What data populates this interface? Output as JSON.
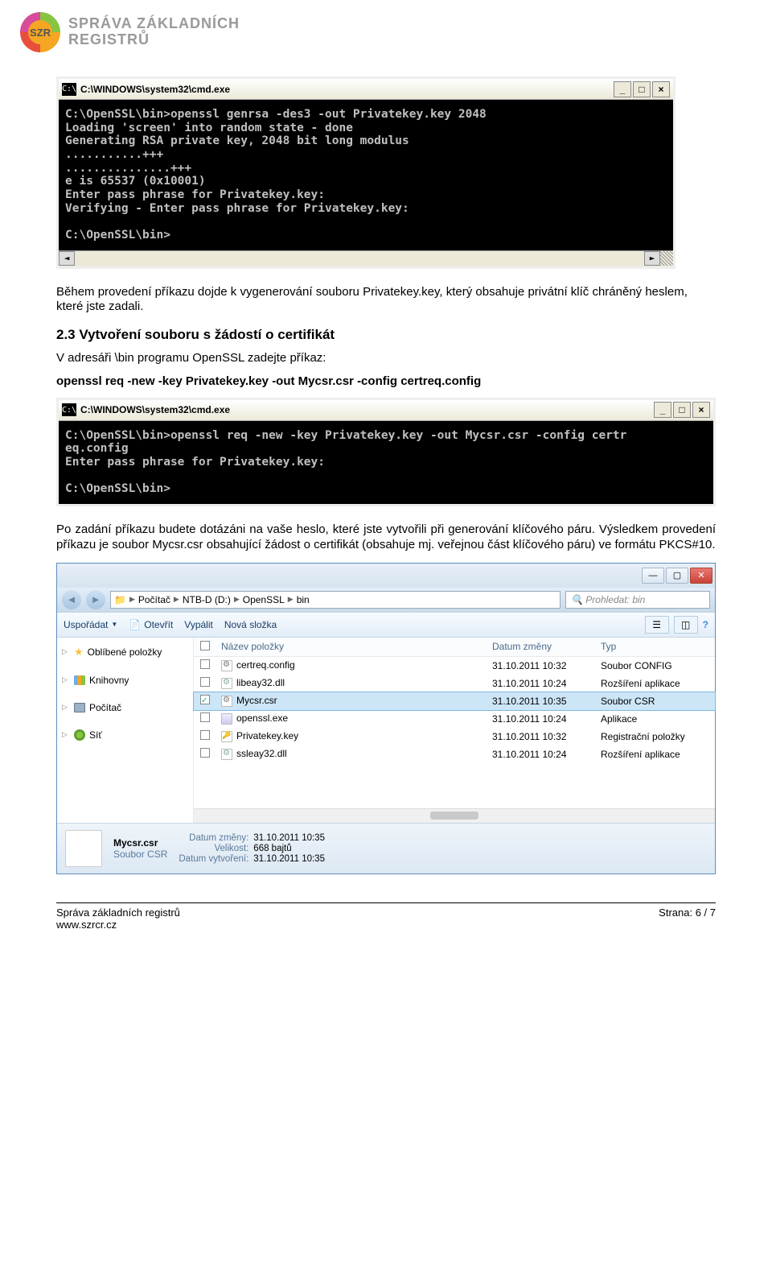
{
  "logo": {
    "abbr": "SZR",
    "title_l1": "SPRÁVA ZÁKLADNÍCH",
    "title_l2": "REGISTRŮ"
  },
  "cmd1": {
    "title": "C:\\WINDOWS\\system32\\cmd.exe",
    "icon_text": "C:\\",
    "body": "C:\\OpenSSL\\bin>openssl genrsa -des3 -out Privatekey.key 2048\nLoading 'screen' into random state - done\nGenerating RSA private key, 2048 bit long modulus\n...........+++\n...............+++\ne is 65537 (0x10001)\nEnter pass phrase for Privatekey.key:\nVerifying - Enter pass phrase for Privatekey.key:\n\nC:\\OpenSSL\\bin>"
  },
  "para1": "Během provedení příkazu dojde k vygenerování souboru Privatekey.key, který obsahuje privátní klíč chráněný heslem, které jste zadali.",
  "heading23": "2.3  Vytvoření souboru s žádostí o certifikát",
  "para2": "V adresáři \\bin programu OpenSSL zadejte příkaz:",
  "command2": "openssl req -new -key Privatekey.key -out Mycsr.csr -config certreq.config",
  "cmd2": {
    "title": "C:\\WINDOWS\\system32\\cmd.exe",
    "icon_text": "C:\\",
    "body": "C:\\OpenSSL\\bin>openssl req -new -key Privatekey.key -out Mycsr.csr -config certr\neq.config\nEnter pass phrase for Privatekey.key:\n\nC:\\OpenSSL\\bin>"
  },
  "para3": "Po zadání příkazu budete dotázáni na vaše heslo, které jste vytvořili při generování klíčového páru. Výsledkem provedení příkazu je soubor Mycsr.csr obsahující žádost o certifikát (obsahuje mj. veřejnou část klíčového páru) ve formátu PKCS#10.",
  "explorer": {
    "breadcrumb": [
      "Počítač",
      "NTB-D (D:)",
      "OpenSSL",
      "bin"
    ],
    "search_placeholder": "Prohledat: bin",
    "toolbar": {
      "organize": "Uspořádat",
      "open": "Otevřít",
      "burn": "Vypálit",
      "newfolder": "Nová složka"
    },
    "tree": {
      "favorites": "Oblíbené položky",
      "libraries": "Knihovny",
      "computer": "Počítač",
      "network": "Síť"
    },
    "columns": {
      "name": "Název položky",
      "date": "Datum změny",
      "type": "Typ"
    },
    "files": [
      {
        "name": "certreq.config",
        "date": "31.10.2011 10:32",
        "type": "Soubor CONFIG",
        "ico": "gear",
        "checked": false
      },
      {
        "name": "libeay32.dll",
        "date": "31.10.2011 10:24",
        "type": "Rozšíření aplikace",
        "ico": "dll",
        "checked": false
      },
      {
        "name": "Mycsr.csr",
        "date": "31.10.2011 10:35",
        "type": "Soubor CSR",
        "ico": "gear",
        "checked": true,
        "selected": true
      },
      {
        "name": "openssl.exe",
        "date": "31.10.2011 10:24",
        "type": "Aplikace",
        "ico": "exe",
        "checked": false
      },
      {
        "name": "Privatekey.key",
        "date": "31.10.2011 10:32",
        "type": "Registrační položky",
        "ico": "key",
        "checked": false
      },
      {
        "name": "ssleay32.dll",
        "date": "31.10.2011 10:24",
        "type": "Rozšíření aplikace",
        "ico": "dll",
        "checked": false
      }
    ],
    "status": {
      "file": "Mycsr.csr",
      "kind": "Soubor CSR",
      "labels": {
        "modified": "Datum změny:",
        "size": "Velikost:",
        "created": "Datum vytvoření:"
      },
      "modified": "31.10.2011 10:35",
      "size": "668 bajtů",
      "created": "31.10.2011 10:35"
    }
  },
  "footer": {
    "org": "Správa základních registrů",
    "url": "www.szrcr.cz",
    "page": "Strana: 6 / 7"
  }
}
